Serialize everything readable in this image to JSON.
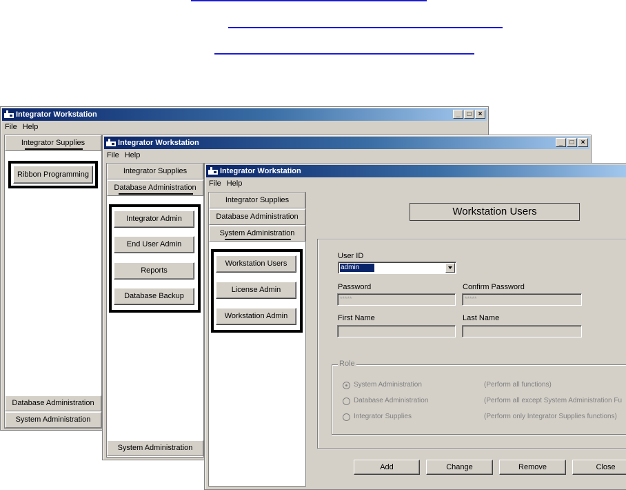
{
  "window_title": "Integrator Workstation",
  "menu": {
    "file": "File",
    "help": "Help"
  },
  "window_buttons": {
    "minimize": "_",
    "maximize": "□",
    "close": "×"
  },
  "nav": {
    "integrator_supplies": "Integrator Supplies",
    "database_administration": "Database Administration",
    "system_administration": "System Administration"
  },
  "win1": {
    "ribbon_programming": "Ribbon Programming"
  },
  "win2": {
    "integrator_admin": "Integrator Admin",
    "end_user_admin": "End User Admin",
    "reports": "Reports",
    "database_backup": "Database Backup"
  },
  "win3": {
    "workstation_users": "Workstation Users",
    "license_admin": "License Admin",
    "workstation_admin": "Workstation Admin",
    "form_title": "Workstation Users",
    "user_id_label": "User ID",
    "user_id_value": "admin",
    "password_label": "Password",
    "password_value": "*****",
    "confirm_password_label": "Confirm Password",
    "confirm_password_value": "*****",
    "first_name_label": "First Name",
    "last_name_label": "Last Name",
    "role_label": "Role",
    "roles": [
      {
        "name": "System Administration",
        "desc": "(Perform all functions)",
        "selected": true
      },
      {
        "name": "Database Administration",
        "desc": "(Perform all except System Administration Fu",
        "selected": false
      },
      {
        "name": "Integrator Supplies",
        "desc": "(Perform only Integrator Supplies functions)",
        "selected": false
      }
    ],
    "buttons": {
      "add": "Add",
      "change": "Change",
      "remove": "Remove",
      "close": "Close"
    }
  },
  "colors": {
    "title_start": "#0a246a",
    "title_end": "#a6caf0",
    "face": "#d4d0c8",
    "link": "#1a1ad8",
    "selection": "#0a246a"
  }
}
